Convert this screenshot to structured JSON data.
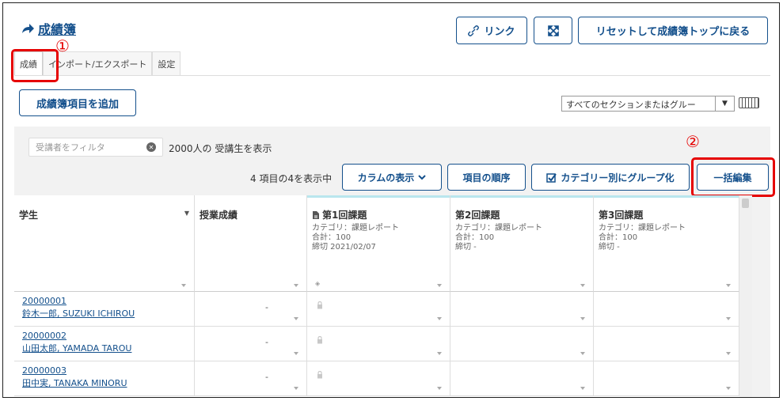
{
  "header": {
    "title": "成績簿",
    "link_button": "リンク",
    "reset_button": "リセットして成績簿トップに戻る"
  },
  "tabs": [
    {
      "label": "成績",
      "active": true
    },
    {
      "label": "インポート/エクスポート",
      "active": false
    },
    {
      "label": "設定",
      "active": false
    }
  ],
  "annotations": {
    "one": "①",
    "two": "②"
  },
  "toolbar": {
    "add_item_button": "成績簿項目を追加",
    "section_select": "すべてのセクションまたはグルー"
  },
  "filter": {
    "placeholder": "受講者をフィルタ",
    "count_text": "2000人の 受講生を表示",
    "showing_text": "4 項目の4を表示中",
    "columns_button": "カラムの表示",
    "order_button": "項目の順序",
    "group_button": "カテゴリー別にグループ化",
    "bulk_edit_button": "一括編集"
  },
  "columns": [
    {
      "name": "学生"
    },
    {
      "name": "授業成績"
    },
    {
      "name": "第1回課題",
      "category": "カテゴリ：課題レポート",
      "total": "合計：100",
      "due": "締切 2021/02/07"
    },
    {
      "name": "第2回課題",
      "category": "カテゴリ：課題レポート",
      "total": "合計：100",
      "due": "締切 -"
    },
    {
      "name": "第3回課題",
      "category": "カテゴリ：課題レポート",
      "total": "合計：100",
      "due": "締切 -"
    }
  ],
  "students": [
    {
      "id": "20000001",
      "name": "鈴木一郎, SUZUKI ICHIROU",
      "grade": "-"
    },
    {
      "id": "20000002",
      "name": "山田太郎, YAMADA TAROU",
      "grade": "-"
    },
    {
      "id": "20000003",
      "name": "田中実, TANAKA MINORU",
      "grade": "-"
    }
  ],
  "colors": {
    "accent": "#14508c",
    "highlight": "#e60000",
    "panel": "#f2f2f2"
  },
  "icons": [
    "share-arrow-icon",
    "link-icon",
    "expand-icon",
    "keyboard-icon",
    "clear-icon",
    "chevron-down-icon",
    "checkbox-icon",
    "document-icon",
    "eye-icon",
    "lock-icon",
    "sort-down-icon"
  ]
}
